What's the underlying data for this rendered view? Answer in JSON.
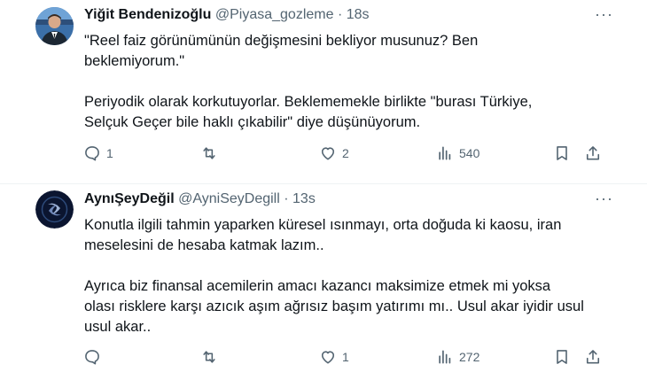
{
  "tweets": [
    {
      "name": "Yiğit Bendenizoğlu",
      "handle": "@Piyasa_gozleme",
      "separator": "·",
      "time": "18s",
      "lines": [
        "\"Reel faiz görünümünün değişmesini bekliyor musunuz? Ben",
        "beklemiyorum.\"",
        "",
        "Periyodik olarak korkutuyorlar. Beklememekle birlikte \"burası Türkiye,",
        "Selçuk Geçer bile haklı çıkabilir\" diye düşünüyorum."
      ],
      "replies": "1",
      "retweets": "",
      "likes": "2",
      "views": "540"
    },
    {
      "name": "AynıŞeyDeğil",
      "handle": "@AyniSeyDegill",
      "separator": "·",
      "time": "13s",
      "lines": [
        "Konutla ilgili tahmin yaparken küresel ısınmayı, orta doğuda ki kaosu, iran",
        "meselesini de hesaba katmak lazım..",
        "",
        "Ayrıca biz finansal acemilerin amacı kazancı maksimize etmek mi yoksa",
        "olası risklere karşı azıcık aşım ağrısız başım yatırımı mı.. Usul akar iyidir usul",
        "usul akar.."
      ],
      "replies": "",
      "retweets": "",
      "likes": "1",
      "views": "272"
    }
  ],
  "more_icon": "···"
}
